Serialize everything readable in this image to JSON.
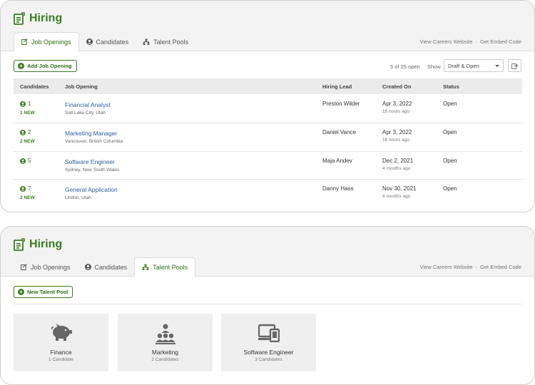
{
  "panel1": {
    "title": "Hiring",
    "tabs": [
      {
        "label": "Job Openings",
        "active": true
      },
      {
        "label": "Candidates",
        "active": false
      },
      {
        "label": "Talent Pools",
        "active": false
      }
    ],
    "header_links": [
      "View Careers Website",
      "·",
      "Get Embed Code"
    ],
    "add_button": "Add Job Opening",
    "count_text": "5 of 25 open",
    "show_label": "Show",
    "filter_value": "Draft & Open",
    "columns": [
      "Candidates",
      "Job Opening",
      "Hiring Lead",
      "Created On",
      "Status"
    ],
    "rows": [
      {
        "count": "1",
        "new": "1 NEW",
        "title": "Financial Analyst",
        "location": "Salt Lake City, Utah",
        "lead": "Preston Wilder",
        "created": "Apr 3, 2022",
        "ago": "18 hours ago",
        "status": "Open"
      },
      {
        "count": "2",
        "new": "2 NEW",
        "title": "Marketing Manager",
        "location": "Vancouver, British Columbia",
        "lead": "Daniel Vance",
        "created": "Apr 3, 2022",
        "ago": "18 hours ago",
        "status": "Open"
      },
      {
        "count": "5",
        "new": "",
        "title": "Software Engineer",
        "location": "Sydney, New South Wales",
        "lead": "Maja Andev",
        "created": "Dec 2, 2021",
        "ago": "4 months ago",
        "status": "Open"
      },
      {
        "count": "7",
        "new": "2 NEW",
        "title": "General Application",
        "location": "Lindon, Utah",
        "lead": "Danny Hass",
        "created": "Nov 30, 2021",
        "ago": "4 months ago",
        "status": "Open"
      }
    ]
  },
  "panel2": {
    "title": "Hiring",
    "tabs": [
      {
        "label": "Job Openings",
        "active": false
      },
      {
        "label": "Candidates",
        "active": false
      },
      {
        "label": "Talent Pools",
        "active": true
      }
    ],
    "header_links": [
      "View Careers Website",
      "·",
      "Get Embed Code"
    ],
    "new_button": "New Talent Pool",
    "pools": [
      {
        "name": "Finance",
        "count": "1 Candidate",
        "icon": "piggy-bank-icon"
      },
      {
        "name": "Marketing",
        "count": "2 Candidates",
        "icon": "org-chart-icon"
      },
      {
        "name": "Software Engineer",
        "count": "3 Candidates",
        "icon": "devices-icon"
      }
    ]
  },
  "colors": {
    "brand_green": "#3a7d21",
    "link_blue": "#2b5f9e"
  }
}
